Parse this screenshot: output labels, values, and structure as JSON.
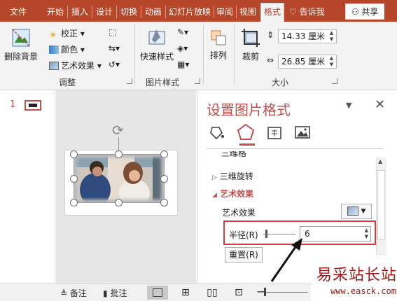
{
  "ribbon_tabs": [
    "文件",
    "开始",
    "插入",
    "设计",
    "切换",
    "动画",
    "幻灯片放映",
    "审阅",
    "视图",
    "格式"
  ],
  "active_tab": "格式",
  "tell_me": "告诉我",
  "share_label": "共享",
  "ribbon": {
    "remove_bg": "删除背景",
    "correction": "校正",
    "color": "颜色",
    "artistic_effects": "艺术效果",
    "adjust_group": "调整",
    "quick_styles": "快速样式",
    "picture_styles_group": "图片样式",
    "arrange": "排列",
    "crop": "裁剪",
    "height_value": "14.33 厘米",
    "width_value": "26.85 厘米",
    "size_group": "大小"
  },
  "slide_number": "1",
  "pane": {
    "title": "设置图片格式",
    "section_cut": "三维格式",
    "section_rotation": "三维旋转",
    "section_artistic": "艺术效果",
    "artistic_label": "艺术效果",
    "radius_label": "半径(R)",
    "radius_value": "6",
    "reset_label": "重置(R)"
  },
  "status": {
    "notes": "备注",
    "comments": "批注"
  },
  "watermark": {
    "text": "易采站长站",
    "url": "www.easck.com"
  },
  "colors": {
    "brand": "#b7472a",
    "pane_title": "#c0504d",
    "highlight": "#d83b3b"
  }
}
